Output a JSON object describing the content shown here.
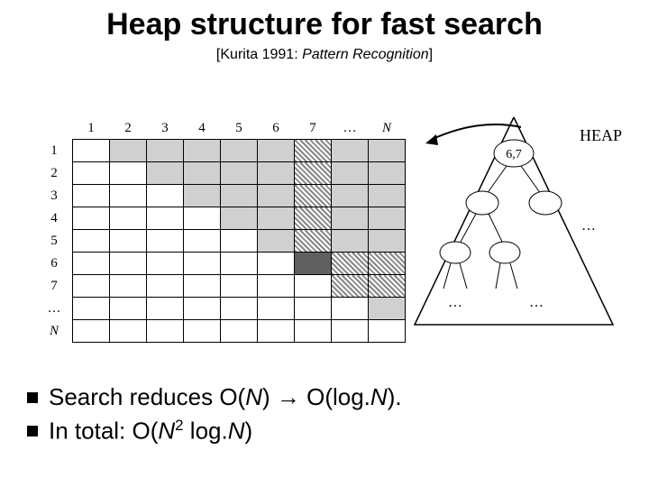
{
  "title": "Heap structure for fast search",
  "citation": {
    "prefix": "[Kurita 1991: ",
    "journal": "Pattern Recognition",
    "suffix": "]"
  },
  "matrix": {
    "cols": [
      "1",
      "2",
      "3",
      "4",
      "5",
      "6",
      "7",
      "…",
      "N"
    ],
    "rows": [
      "1",
      "2",
      "3",
      "4",
      "5",
      "6",
      "7",
      "…",
      "N"
    ]
  },
  "heap": {
    "label": "HEAP",
    "root": "6,7",
    "ell": "…"
  },
  "bullets": {
    "b1_a": "Search reduces O(",
    "b1_b": ") → O(log.",
    "b1_c": ").",
    "b2_a": "In total: O(",
    "b2_b": " log.",
    "b2_c": ")",
    "N": "N",
    "sq": "2"
  }
}
